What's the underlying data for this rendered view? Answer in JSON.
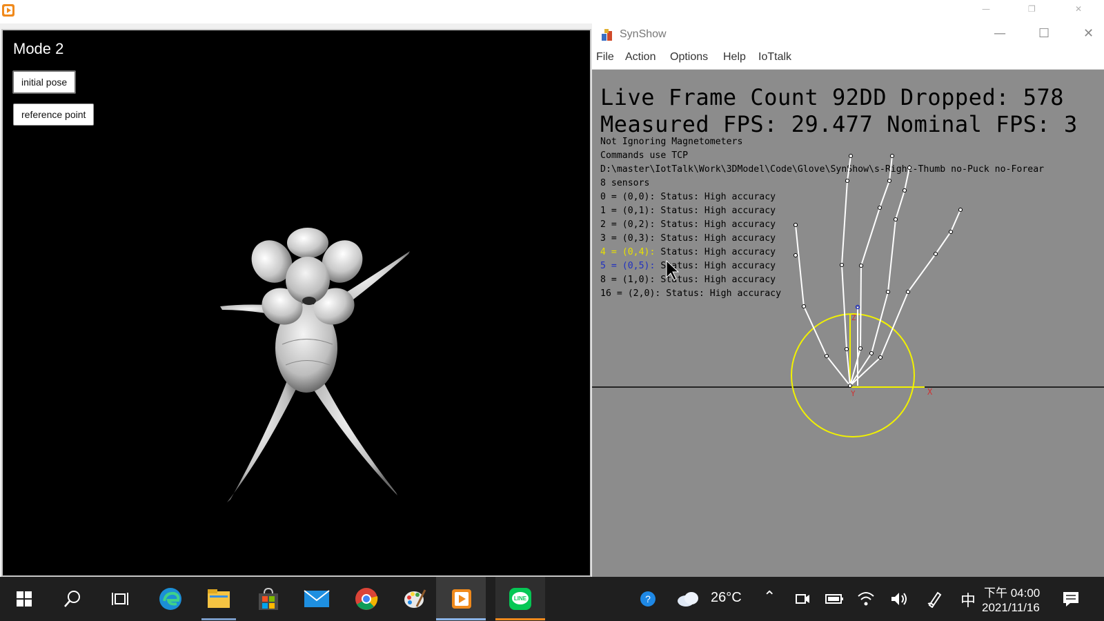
{
  "player": {
    "mode_title": "Mode 2",
    "buttons": {
      "initial_pose": "initial pose",
      "reference_point": "reference point"
    }
  },
  "synshow": {
    "title": "SynShow",
    "menu": [
      "File",
      "Action",
      "Options",
      "Help",
      "IoTtalk"
    ],
    "big_lines": [
      "Live Frame Count 92DD Dropped: 578",
      "Measured FPS: 29.477 Nominal FPS: 3"
    ],
    "info_lines": [
      "Not Ignoring Magnetometers",
      "Commands use TCP",
      "D:\\master\\IotTalk\\Work\\3DModel\\Code\\Glove\\SynShow\\s-Right-Thumb no-Puck no-Forear",
      "8 sensors"
    ],
    "sensors": [
      {
        "prefix": "0 = (0,0): ",
        "status": "Status: High accuracy"
      },
      {
        "prefix": "1 = (0,1): ",
        "status": "Status: High accuracy"
      },
      {
        "prefix": "2 = (0,2): ",
        "status": "Status: High accuracy"
      },
      {
        "prefix": "3 = (0,3): ",
        "status": "Status: High accuracy"
      },
      {
        "prefix": "4 = (0,4): ",
        "status": "Status: High accuracy"
      },
      {
        "prefix": "5 = (0,5): ",
        "status": "Status: High accuracy"
      },
      {
        "prefix": "8 = (1,0): ",
        "status": "Status: High accuracy"
      },
      {
        "prefix": "16 = (2,0): ",
        "status": "Status: High accuracy"
      }
    ],
    "axis_labels": {
      "x": "X",
      "y": "Y",
      "z": "Z"
    },
    "colors": {
      "circle": "#f2f200",
      "axis_x": "#f2f200",
      "axis_label": "#d03030",
      "skeleton": "#ffffff"
    }
  },
  "taskbar": {
    "icons": [
      "start-icon",
      "search-icon",
      "task-view-icon",
      "edge-icon",
      "file-explorer-icon",
      "store-icon",
      "mail-icon",
      "chrome-icon",
      "paint-icon",
      "media-player-icon",
      "line-icon"
    ],
    "weather": "26°C",
    "ime": "中",
    "time": "下午 04:00",
    "date": "2021/11/16"
  }
}
